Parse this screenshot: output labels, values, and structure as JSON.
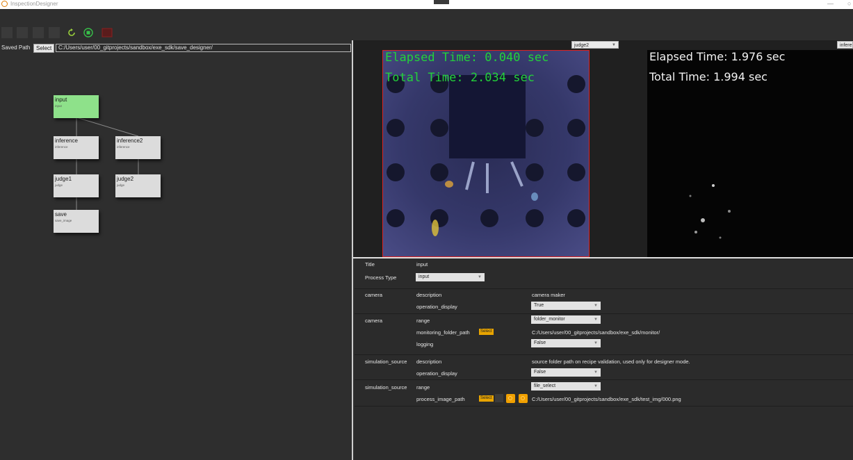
{
  "window": {
    "title": "InspectionDesigner"
  },
  "toolbar": {
    "reload_icon": "reload-icon",
    "run_icon": "run-icon",
    "stop_icon": "stop-icon",
    "colors": {
      "reload": "#9ad13b",
      "run": "#38c04a",
      "stop": "#8a1f1f"
    }
  },
  "saved_path": {
    "label": "Saved Path",
    "select_label": "Select",
    "value": "C:/Users/user/00_gitprojects/sandbox/exe_sdk/save_designer/"
  },
  "graph": {
    "nodes": [
      {
        "title": "input",
        "sub": "input",
        "active": true
      },
      {
        "title": "inference",
        "sub": "inference"
      },
      {
        "title": "inference2",
        "sub": "inference"
      },
      {
        "title": "judge1",
        "sub": "judge"
      },
      {
        "title": "judge2",
        "sub": "judge"
      },
      {
        "title": "save",
        "sub": "save_image"
      }
    ],
    "colors": {
      "active": "#8ee18a",
      "node": "#dcdcdc"
    }
  },
  "viewer": {
    "left_select": "judge2",
    "right_select": "infere",
    "left_overlay": {
      "elapsed": "Elapsed Time: 0.040 sec",
      "total": "Total Time: 2.034 sec",
      "color": "#23d23a"
    },
    "right_overlay": {
      "elapsed": "Elapsed Time: 1.976 sec",
      "total": "Total Time: 1.994 sec",
      "color": "#f2f2f2"
    }
  },
  "properties": {
    "title_label": "Title",
    "title_value": "input",
    "process_type_label": "Process Type",
    "process_type_value": "input",
    "groups": [
      {
        "name": "camera",
        "rows": [
          {
            "key": "description",
            "value": "camera maker"
          },
          {
            "key": "operation_display",
            "select": "True"
          }
        ]
      },
      {
        "name": "camera",
        "rows": [
          {
            "key": "range",
            "select": "folder_monitor"
          },
          {
            "key": "monitoring_folder_path",
            "button": "Select",
            "value": "C:/Users/user/00_gitprojects/sandbox/exe_sdk/monitor/"
          },
          {
            "key": "logging",
            "select": "False"
          }
        ]
      },
      {
        "name": "simulation_source",
        "rows": [
          {
            "key": "description",
            "value": "source folder path on recipe validation, used only for designer mode."
          },
          {
            "key": "operation_display",
            "select": "False"
          }
        ]
      },
      {
        "name": "simulation_source",
        "rows": [
          {
            "key": "range",
            "select": "file_select"
          },
          {
            "key": "process_image_path",
            "button": "Select",
            "value": "C:/Users/user/00_gitprojects/sandbox/exe_sdk/test_img/000.png"
          }
        ]
      }
    ]
  }
}
